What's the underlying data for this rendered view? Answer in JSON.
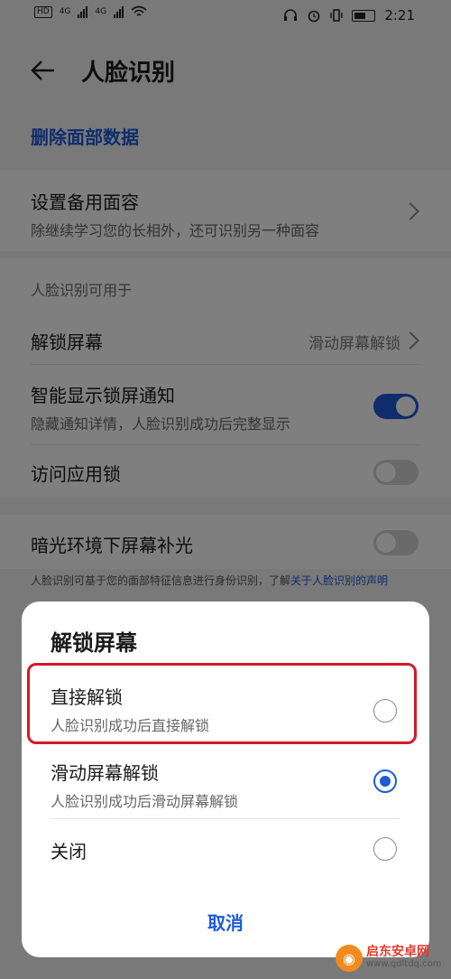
{
  "status_bar": {
    "left_chips": [
      "HD",
      "HD"
    ],
    "network_labels": [
      "4G",
      "4G"
    ],
    "time": "2:21",
    "icons": [
      "wifi-icon",
      "headset-icon",
      "alarm-icon",
      "vibrate-icon",
      "battery-icon"
    ]
  },
  "header": {
    "title": "人脸识别",
    "back_icon": "arrow-left-icon"
  },
  "delete": {
    "label": "删除面部数据"
  },
  "backup_face": {
    "title": "设置备用面容",
    "subtitle": "除继续学习您的长相外，还可识别另一种面容"
  },
  "usage": {
    "section_label": "人脸识别可用于",
    "unlock": {
      "title": "解锁屏幕",
      "value": "滑动屏幕解锁"
    },
    "smart_notify": {
      "title": "智能显示锁屏通知",
      "subtitle": "隐藏通知详情，人脸识别成功后完整显示",
      "enabled": true
    },
    "app_lock": {
      "title": "访问应用锁",
      "enabled": false
    }
  },
  "fill_light": {
    "title": "暗光环境下屏幕补光",
    "enabled": false
  },
  "footnote": {
    "text": "人脸识别可基于您的面部特征信息进行身份识别，了解",
    "link": "关于人脸识别的声明"
  },
  "dialog": {
    "title": "解锁屏幕",
    "options": [
      {
        "title": "直接解锁",
        "subtitle": "人脸识别成功后直接解锁",
        "selected": false
      },
      {
        "title": "滑动屏幕解锁",
        "subtitle": "人脸识别成功后滑动屏幕解锁",
        "selected": true
      },
      {
        "title": "关闭",
        "subtitle": "",
        "selected": false
      }
    ],
    "cancel_label": "取消"
  },
  "watermark": {
    "name": "启东安卓网",
    "url": "www.qdltdq.com"
  },
  "colors": {
    "accent": "#1e5bd8",
    "highlight": "#d11a2a",
    "dim_overlay": "rgba(0,0,0,0.5)"
  }
}
